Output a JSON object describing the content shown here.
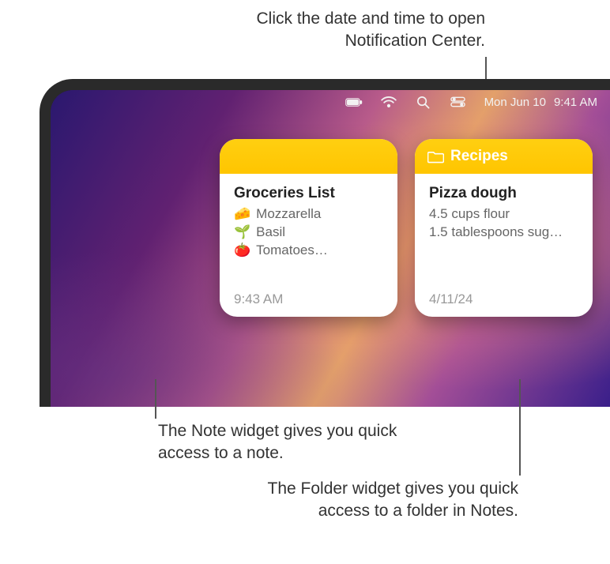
{
  "callouts": {
    "top": "Click the date and time to open Notification Center.",
    "note": "The Note widget gives you quick access to a note.",
    "folder": "The Folder widget gives you quick access to a folder in Notes."
  },
  "menubar": {
    "battery_icon": "battery-icon",
    "wifi_icon": "wifi-icon",
    "spotlight_icon": "search-icon",
    "control_center_icon": "control-center-icon",
    "date": "Mon Jun 10",
    "time": "9:41 AM"
  },
  "widgets": {
    "note": {
      "title": "Groceries List",
      "items": [
        {
          "emoji": "🧀",
          "text": "Mozzarella"
        },
        {
          "emoji": "🌱",
          "text": "Basil"
        },
        {
          "emoji": "🍅",
          "text": "Tomatoes…"
        }
      ],
      "timestamp": "9:43 AM"
    },
    "folder": {
      "header_icon": "folder-icon",
      "header_label": "Recipes",
      "title": "Pizza dough",
      "lines": [
        "4.5 cups flour",
        "1.5 tablespoons sug…"
      ],
      "timestamp": "4/11/24"
    }
  }
}
